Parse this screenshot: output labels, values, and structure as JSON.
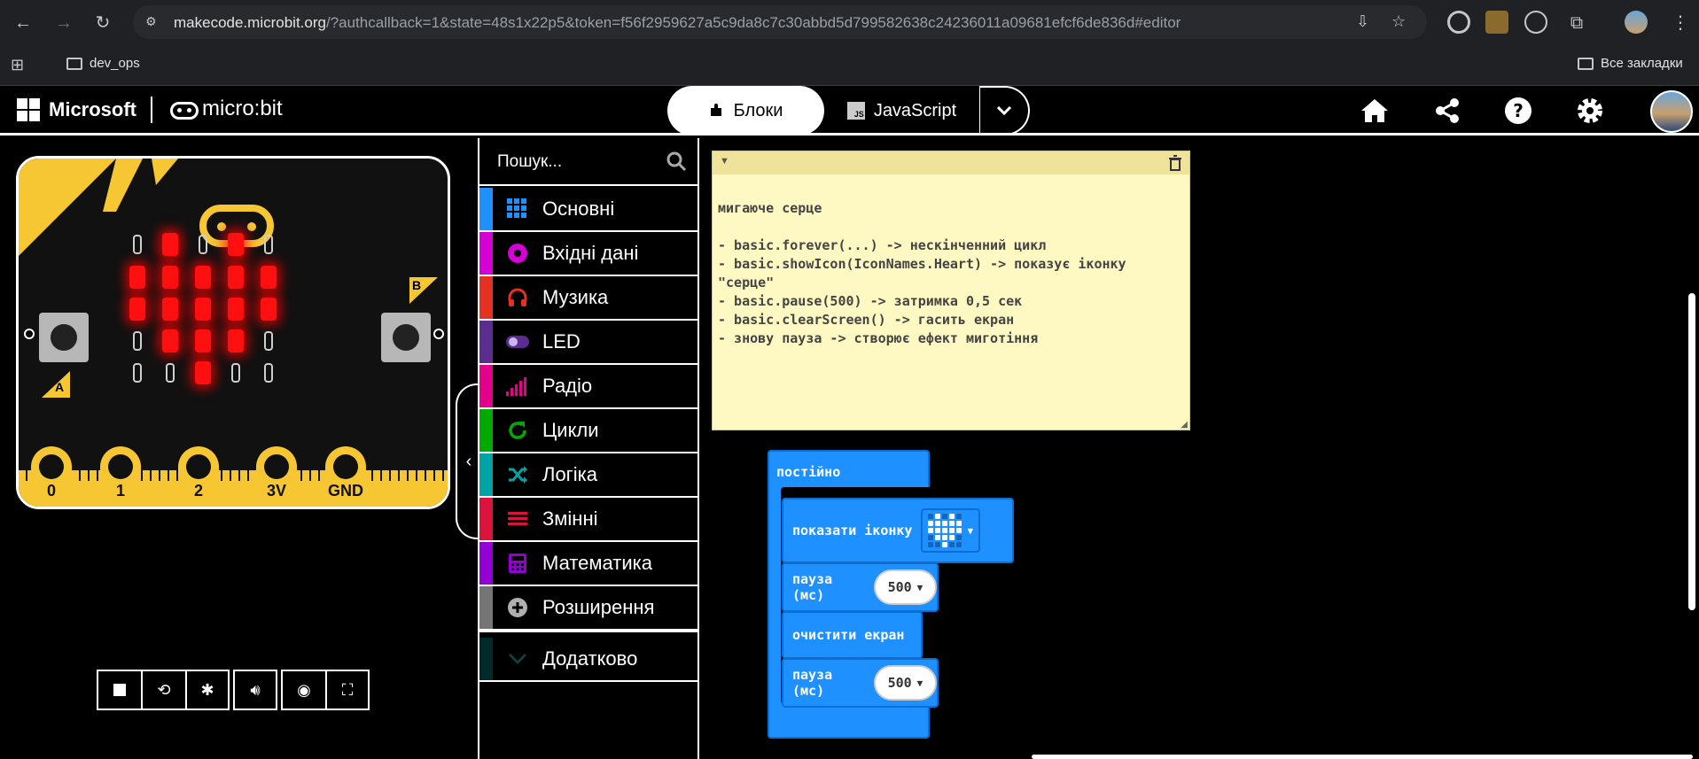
{
  "browser": {
    "url_host": "makecode.microbit.org",
    "url_rest": "/?authcallback=1&state=48s1x22p5&token=f56f2959627a5c9da8c7c30abbd5d799582638c24236011a09681efcf6de836d#editor",
    "bookmark_folder": "dev_ops",
    "all_bookmarks": "Все закладки"
  },
  "header": {
    "microsoft": "Microsoft",
    "microbit": "micro:bit",
    "tab_blocks": "Блоки",
    "tab_js": "JavaScript",
    "js_badge": "JS"
  },
  "simulator": {
    "button_a": "A",
    "button_b": "B",
    "pins": [
      "0",
      "1",
      "2",
      "3V",
      "GND"
    ],
    "leds": [
      [
        0,
        1,
        0,
        1,
        0
      ],
      [
        1,
        1,
        1,
        1,
        1
      ],
      [
        1,
        1,
        1,
        1,
        1
      ],
      [
        0,
        1,
        1,
        1,
        0
      ],
      [
        0,
        0,
        1,
        0,
        0
      ]
    ]
  },
  "toolbox": {
    "search_placeholder": "Пошук...",
    "categories": [
      {
        "label": "Основні",
        "color": "#1e90ff"
      },
      {
        "label": "Вхідні дані",
        "color": "#d400d4"
      },
      {
        "label": "Музика",
        "color": "#e63022"
      },
      {
        "label": "LED",
        "color": "#5c2d91"
      },
      {
        "label": "Радіо",
        "color": "#e3008c"
      },
      {
        "label": "Цикли",
        "color": "#00aa00"
      },
      {
        "label": "Логіка",
        "color": "#00a4a6"
      },
      {
        "label": "Змінні",
        "color": "#dc143c"
      },
      {
        "label": "Математика",
        "color": "#9400d3"
      },
      {
        "label": "Розширення",
        "color": "#757575"
      }
    ],
    "advanced": "Додатково"
  },
  "comment": {
    "text": "мигаюче серце\n\n- basic.forever(...) -> нескінченний цикл\n- basic.showIcon(IconNames.Heart) -> показує іконку\n\"серце\"\n- basic.pause(500) -> затримка 0,5 сек\n- basic.clearScreen() -> гасить екран\n- знову пауза -> створює ефект миготіння"
  },
  "blocks": {
    "forever": "постійно",
    "show_icon": "показати іконку",
    "pause1": "пауза (мс)",
    "pause1_value": "500",
    "clear": "очистити екран",
    "pause2": "пауза (мс)",
    "pause2_value": "500"
  },
  "colors": {
    "block_blue": "#1e90ff",
    "led_on": "#ff1010",
    "board_gold": "#f6c633"
  }
}
